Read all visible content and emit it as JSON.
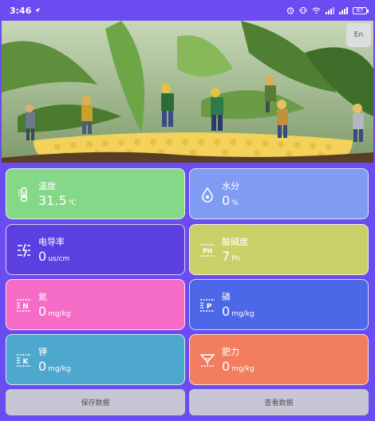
{
  "status_bar": {
    "time": "3:46",
    "battery": "87"
  },
  "hero": {
    "lang_button": "En"
  },
  "cards": [
    {
      "title": "温度",
      "value": "31.5",
      "unit": "℃",
      "color": "#86d889",
      "icon": "thermometer-icon"
    },
    {
      "title": "水分",
      "value": "0",
      "unit": "%",
      "color": "#7f9cf2",
      "icon": "water-drop-icon"
    },
    {
      "title": "电导率",
      "value": "0",
      "unit": "us/cm",
      "color": "#5c3fe0",
      "icon": "conductivity-icon"
    },
    {
      "title": "酸碱度",
      "value": "7",
      "unit": "Ph",
      "color": "#cbcf68",
      "icon": "ph-icon"
    },
    {
      "title": "氮",
      "value": "0",
      "unit": "mg/kg",
      "color": "#f56cc6",
      "icon": "nitrogen-icon"
    },
    {
      "title": "磷",
      "value": "0",
      "unit": "mg/kg",
      "color": "#4d68e6",
      "icon": "phosphorus-icon"
    },
    {
      "title": "钾",
      "value": "0",
      "unit": "mg/kg",
      "color": "#4ea7cd",
      "icon": "potassium-icon"
    },
    {
      "title": "肥力",
      "value": "0",
      "unit": "mg/kg",
      "color": "#f27d5f",
      "icon": "fertility-icon"
    }
  ],
  "buttons": {
    "save": "保存数据",
    "view": "查看数据"
  }
}
